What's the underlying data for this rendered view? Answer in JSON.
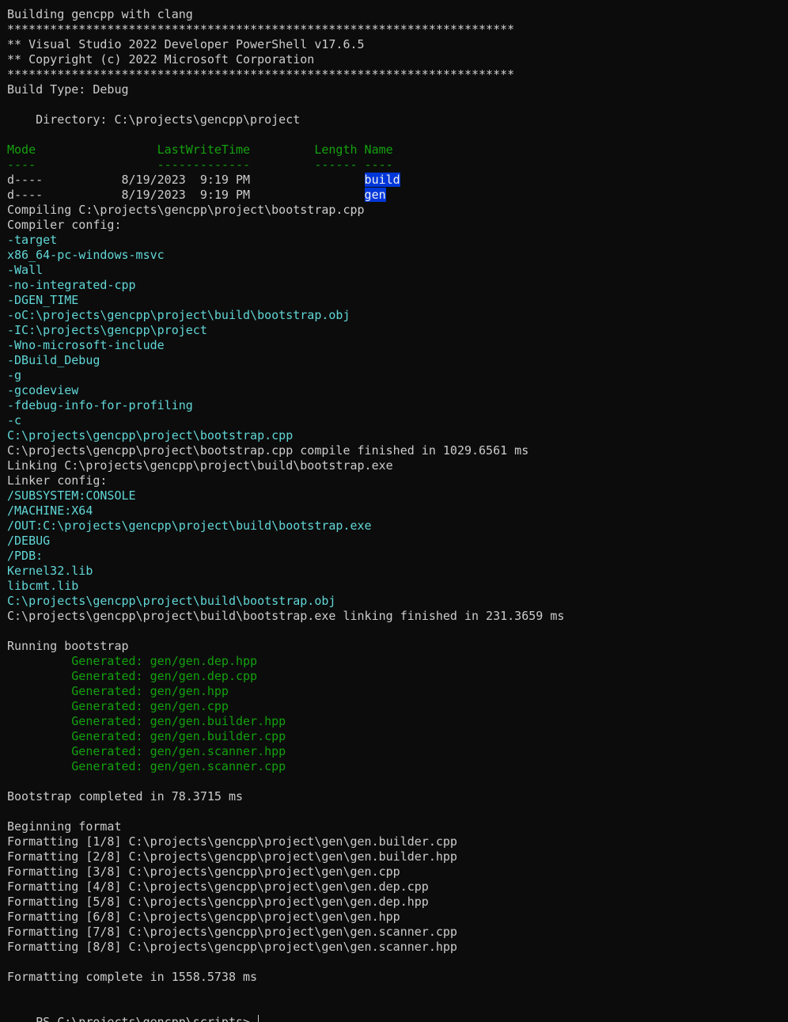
{
  "theme": {
    "background": "#0c0c0c",
    "foreground": "#cccccc",
    "green": "#13a10e",
    "cyan": "#61d6d6",
    "highlight_bg": "#0037da",
    "highlight_fg": "#f2f2f2"
  },
  "lines": [
    [
      {
        "t": "Building gencpp with clang"
      }
    ],
    [
      {
        "t": "***********************************************************************"
      }
    ],
    [
      {
        "t": "** Visual Studio 2022 Developer PowerShell v17.6.5"
      }
    ],
    [
      {
        "t": "** Copyright (c) 2022 Microsoft Corporation"
      }
    ],
    [
      {
        "t": "***********************************************************************"
      }
    ],
    [
      {
        "t": "Build Type: Debug"
      }
    ],
    [
      {
        "t": ""
      }
    ],
    [
      {
        "t": "    Directory: C:\\projects\\gencpp\\project"
      }
    ],
    [
      {
        "t": ""
      }
    ],
    [
      {
        "t": "Mode                 LastWriteTime         Length Name",
        "c": "green"
      }
    ],
    [
      {
        "t": "----                 -------------         ------ ----",
        "c": "green"
      }
    ],
    [
      {
        "t": "d----           8/19/2023  9:19 PM                "
      },
      {
        "t": "build",
        "c": "highlight"
      }
    ],
    [
      {
        "t": "d----           8/19/2023  9:19 PM                "
      },
      {
        "t": "gen",
        "c": "highlight"
      }
    ],
    [
      {
        "t": "Compiling C:\\projects\\gencpp\\project\\bootstrap.cpp"
      }
    ],
    [
      {
        "t": "Compiler config:"
      }
    ],
    [
      {
        "t": "-target",
        "c": "cyan"
      }
    ],
    [
      {
        "t": "x86_64-pc-windows-msvc",
        "c": "cyan"
      }
    ],
    [
      {
        "t": "-Wall",
        "c": "cyan"
      }
    ],
    [
      {
        "t": "-no-integrated-cpp",
        "c": "cyan"
      }
    ],
    [
      {
        "t": "-DGEN_TIME",
        "c": "cyan"
      }
    ],
    [
      {
        "t": "-oC:\\projects\\gencpp\\project\\build\\bootstrap.obj",
        "c": "cyan"
      }
    ],
    [
      {
        "t": "-IC:\\projects\\gencpp\\project",
        "c": "cyan"
      }
    ],
    [
      {
        "t": "-Wno-microsoft-include",
        "c": "cyan"
      }
    ],
    [
      {
        "t": "-DBuild_Debug",
        "c": "cyan"
      }
    ],
    [
      {
        "t": "-g",
        "c": "cyan"
      }
    ],
    [
      {
        "t": "-gcodeview",
        "c": "cyan"
      }
    ],
    [
      {
        "t": "-fdebug-info-for-profiling",
        "c": "cyan"
      }
    ],
    [
      {
        "t": "-c",
        "c": "cyan"
      }
    ],
    [
      {
        "t": "C:\\projects\\gencpp\\project\\bootstrap.cpp",
        "c": "cyan"
      }
    ],
    [
      {
        "t": "C:\\projects\\gencpp\\project\\bootstrap.cpp compile finished in 1029.6561 ms"
      }
    ],
    [
      {
        "t": "Linking C:\\projects\\gencpp\\project\\build\\bootstrap.exe"
      }
    ],
    [
      {
        "t": "Linker config:"
      }
    ],
    [
      {
        "t": "/SUBSYSTEM:CONSOLE",
        "c": "cyan"
      }
    ],
    [
      {
        "t": "/MACHINE:X64",
        "c": "cyan"
      }
    ],
    [
      {
        "t": "/OUT:C:\\projects\\gencpp\\project\\build\\bootstrap.exe",
        "c": "cyan"
      }
    ],
    [
      {
        "t": "/DEBUG",
        "c": "cyan"
      }
    ],
    [
      {
        "t": "/PDB:",
        "c": "cyan"
      }
    ],
    [
      {
        "t": "Kernel32.lib",
        "c": "cyan"
      }
    ],
    [
      {
        "t": "libcmt.lib",
        "c": "cyan"
      }
    ],
    [
      {
        "t": "C:\\projects\\gencpp\\project\\build\\bootstrap.obj",
        "c": "cyan"
      }
    ],
    [
      {
        "t": "C:\\projects\\gencpp\\project\\build\\bootstrap.exe linking finished in 231.3659 ms"
      }
    ],
    [
      {
        "t": ""
      }
    ],
    [
      {
        "t": "Running bootstrap"
      }
    ],
    [
      {
        "t": "         Generated: gen/gen.dep.hpp",
        "c": "green"
      }
    ],
    [
      {
        "t": "         Generated: gen/gen.dep.cpp",
        "c": "green"
      }
    ],
    [
      {
        "t": "         Generated: gen/gen.hpp",
        "c": "green"
      }
    ],
    [
      {
        "t": "         Generated: gen/gen.cpp",
        "c": "green"
      }
    ],
    [
      {
        "t": "         Generated: gen/gen.builder.hpp",
        "c": "green"
      }
    ],
    [
      {
        "t": "         Generated: gen/gen.builder.cpp",
        "c": "green"
      }
    ],
    [
      {
        "t": "         Generated: gen/gen.scanner.hpp",
        "c": "green"
      }
    ],
    [
      {
        "t": "         Generated: gen/gen.scanner.cpp",
        "c": "green"
      }
    ],
    [
      {
        "t": ""
      }
    ],
    [
      {
        "t": "Bootstrap completed in 78.3715 ms"
      }
    ],
    [
      {
        "t": ""
      }
    ],
    [
      {
        "t": "Beginning format"
      }
    ],
    [
      {
        "t": "Formatting [1/8] C:\\projects\\gencpp\\project\\gen\\gen.builder.cpp"
      }
    ],
    [
      {
        "t": "Formatting [2/8] C:\\projects\\gencpp\\project\\gen\\gen.builder.hpp"
      }
    ],
    [
      {
        "t": "Formatting [3/8] C:\\projects\\gencpp\\project\\gen\\gen.cpp"
      }
    ],
    [
      {
        "t": "Formatting [4/8] C:\\projects\\gencpp\\project\\gen\\gen.dep.cpp"
      }
    ],
    [
      {
        "t": "Formatting [5/8] C:\\projects\\gencpp\\project\\gen\\gen.dep.hpp"
      }
    ],
    [
      {
        "t": "Formatting [6/8] C:\\projects\\gencpp\\project\\gen\\gen.hpp"
      }
    ],
    [
      {
        "t": "Formatting [7/8] C:\\projects\\gencpp\\project\\gen\\gen.scanner.cpp"
      }
    ],
    [
      {
        "t": "Formatting [8/8] C:\\projects\\gencpp\\project\\gen\\gen.scanner.hpp"
      }
    ],
    [
      {
        "t": ""
      }
    ],
    [
      {
        "t": "Formatting complete in 1558.5738 ms"
      }
    ],
    [
      {
        "t": ""
      }
    ]
  ],
  "prompt": {
    "text": "PS C:\\projects\\gencpp\\scripts> "
  }
}
